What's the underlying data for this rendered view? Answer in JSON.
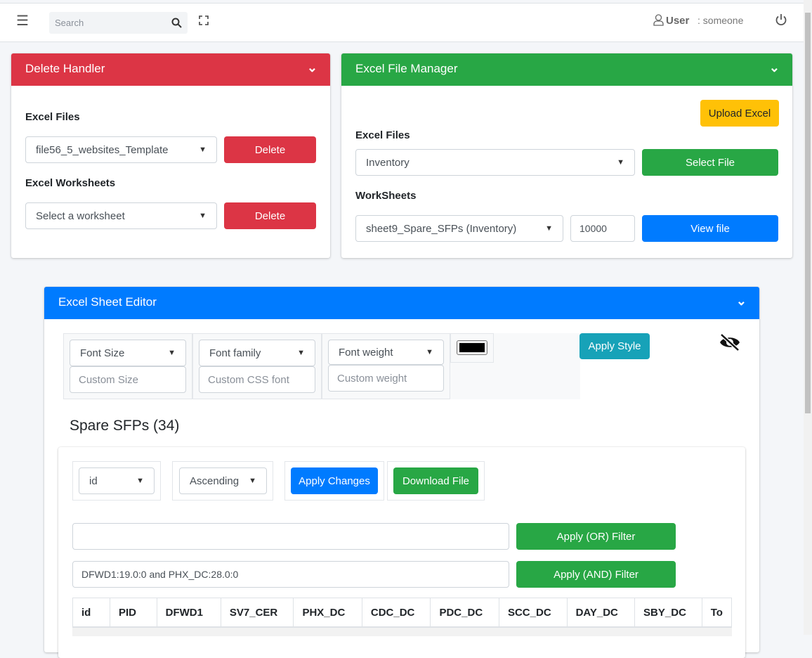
{
  "nav": {
    "search_placeholder": "Search",
    "user_label": "User",
    "user_name": ": someone"
  },
  "delete_handler": {
    "title": "Delete Handler",
    "excel_files_label": "Excel Files",
    "file_selected": "file56_5_websites_Template",
    "delete_label": "Delete",
    "worksheets_label": "Excel Worksheets",
    "worksheet_selected": "Select a worksheet",
    "delete2_label": "Delete",
    "color": "#dc3545"
  },
  "file_manager": {
    "title": "Excel File Manager",
    "upload_label": "Upload Excel",
    "excel_files_label": "Excel Files",
    "file_selected": "Inventory",
    "select_file_label": "Select File",
    "worksheets_label": "WorkSheets",
    "worksheet_selected": "sheet9_Spare_SFPs (Inventory)",
    "row_limit": "10000",
    "view_label": "View file",
    "color": "#28a745"
  },
  "editor": {
    "title": "Excel Sheet Editor",
    "color": "#007bff",
    "font_size": "Font Size",
    "custom_size": "Custom Size",
    "font_family": "Font family",
    "custom_font": "Custom CSS font",
    "font_weight": "Font weight",
    "custom_weight": "Custom weight",
    "color_value": "#000000",
    "apply_style": "Apply Style",
    "sheet_title": "Spare SFPs (34)",
    "sort_column": "id",
    "sort_order": "Ascending",
    "apply_changes": "Apply Changes",
    "download": "Download File",
    "or_filter_value": "",
    "or_filter_label": "Apply (OR) Filter",
    "and_filter_value": "DFWD1:19.0:0 and PHX_DC:28.0:0",
    "and_filter_label": "Apply (AND) Filter",
    "columns": [
      "id",
      "PID",
      "DFWD1",
      "SV7_CER",
      "PHX_DC",
      "CDC_DC",
      "PDC_DC",
      "SCC_DC",
      "DAY_DC",
      "SBY_DC",
      "To"
    ]
  }
}
